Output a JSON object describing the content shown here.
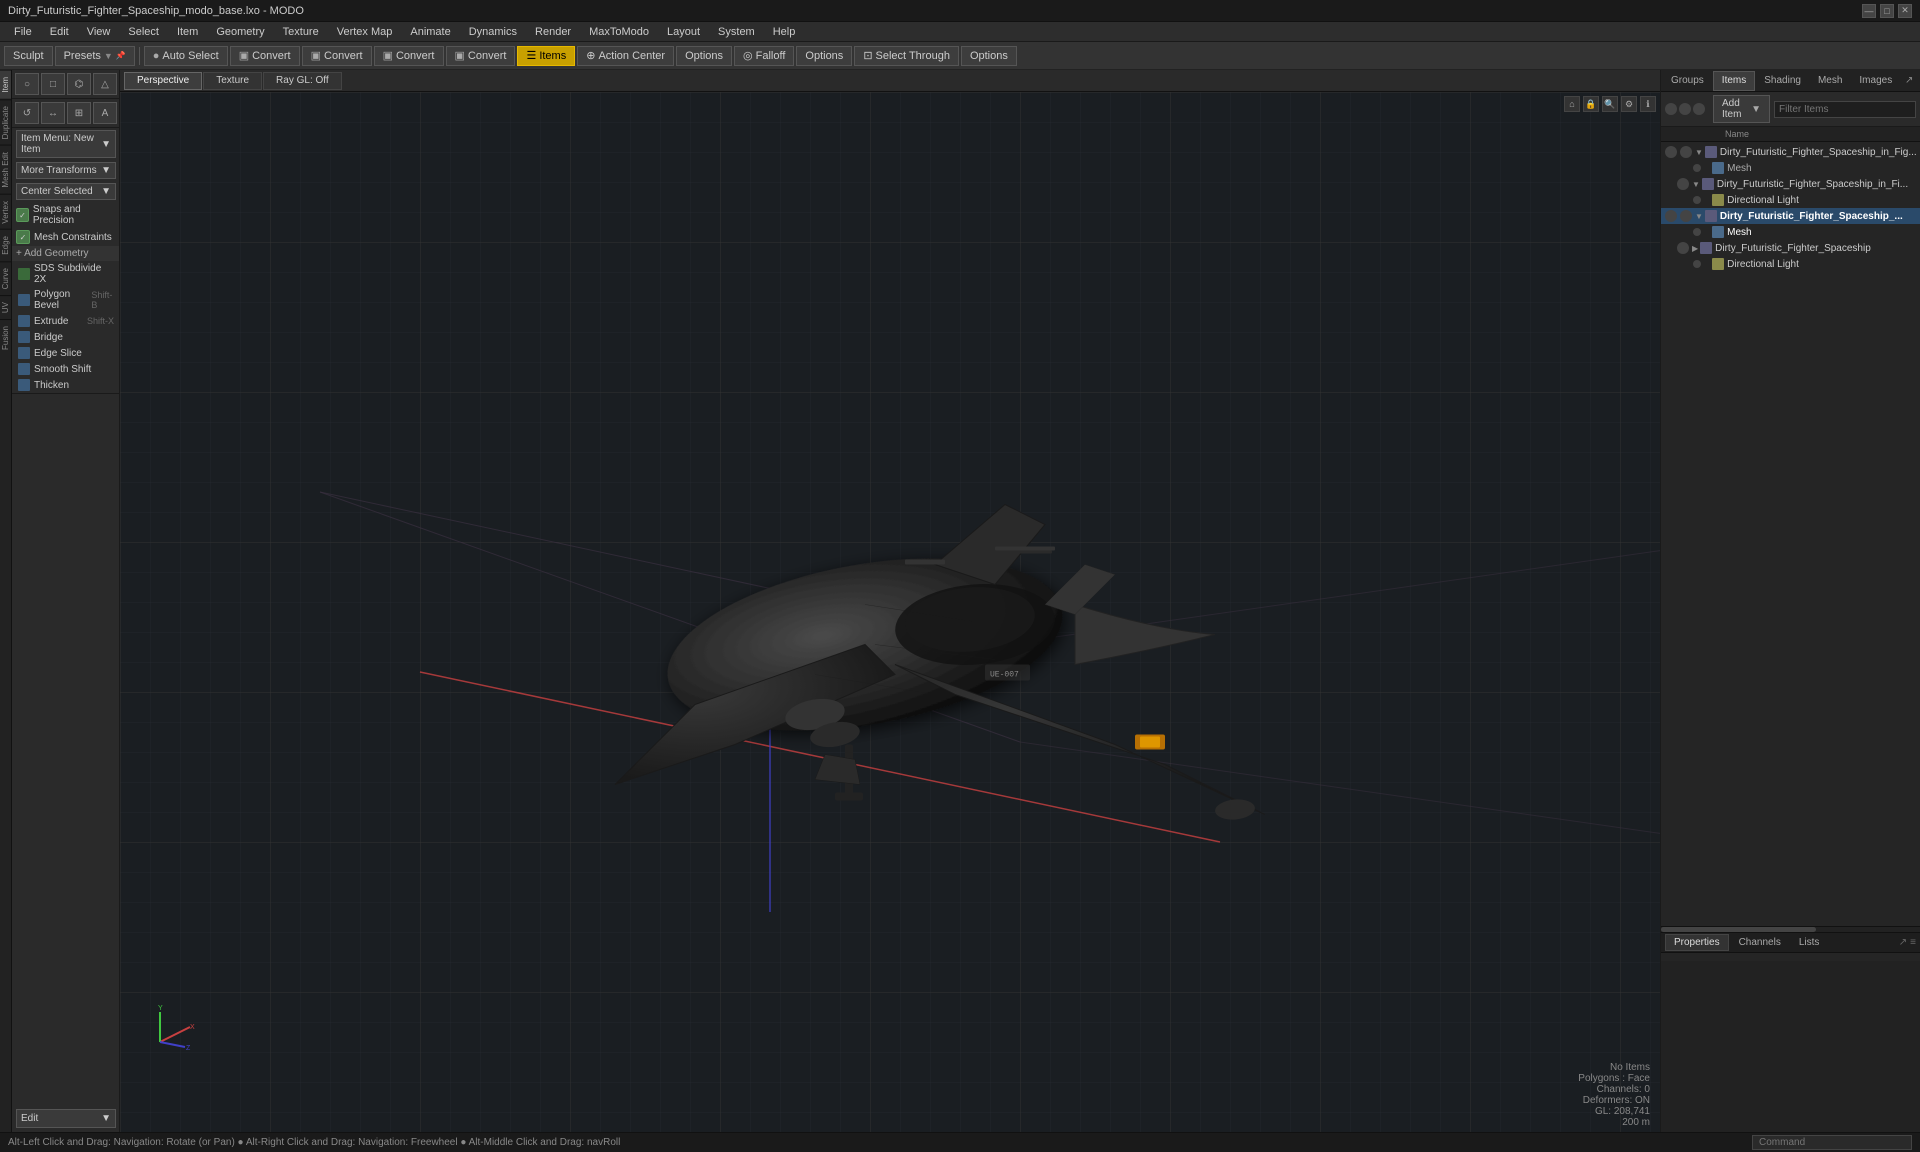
{
  "titlebar": {
    "title": "Dirty_Futuristic_Fighter_Spaceship_modo_base.lxo - MODO",
    "controls": [
      "—",
      "□",
      "✕"
    ]
  },
  "menubar": {
    "items": [
      "File",
      "Edit",
      "View",
      "Select",
      "Item",
      "Geometry",
      "Texture",
      "Vertex Map",
      "Animate",
      "Dynamics",
      "Render",
      "MaxToModo",
      "Layout",
      "System",
      "Help"
    ]
  },
  "toolbar": {
    "sculpt_label": "Sculpt",
    "presets_label": "Presets",
    "buttons": [
      {
        "label": "Auto Select",
        "icon": "●",
        "active": false
      },
      {
        "label": "Convert",
        "icon": "▣",
        "active": false
      },
      {
        "label": "Convert",
        "icon": "▣",
        "active": false
      },
      {
        "label": "Convert",
        "icon": "▣",
        "active": false
      },
      {
        "label": "Convert",
        "icon": "▣",
        "active": false
      },
      {
        "label": "Items",
        "icon": "☰",
        "active": true
      },
      {
        "label": "Action Center",
        "icon": "⊕",
        "active": false
      },
      {
        "label": "Options",
        "icon": "",
        "active": false
      },
      {
        "label": "Falloff",
        "icon": "◎",
        "active": false
      },
      {
        "label": "Options",
        "icon": "",
        "active": false
      },
      {
        "label": "Select Through",
        "icon": "⊡",
        "active": false
      },
      {
        "label": "Options",
        "icon": "",
        "active": false
      }
    ]
  },
  "left_panel": {
    "tool_icons_row1": [
      {
        "icon": "○",
        "name": "sphere"
      },
      {
        "icon": "□",
        "name": "box"
      },
      {
        "icon": "⌬",
        "name": "cone"
      },
      {
        "icon": "△",
        "name": "tri"
      }
    ],
    "tool_icons_row2": [
      {
        "icon": "↺",
        "name": "rotate"
      },
      {
        "icon": "↔",
        "name": "move"
      },
      {
        "icon": "⊞",
        "name": "scale"
      },
      {
        "icon": "A",
        "name": "text"
      }
    ],
    "dropdowns": [
      {
        "label": "Item Menu: New Item",
        "value": "Item Menu: New Item"
      },
      {
        "label": "More Transforms",
        "value": "More Transforms"
      },
      {
        "label": "Center Selected",
        "value": "Center Selected"
      }
    ],
    "tools": [
      {
        "label": "Snaps and Precision",
        "icon": "check",
        "shortcut": ""
      },
      {
        "label": "Mesh Constraints",
        "icon": "check",
        "shortcut": ""
      }
    ],
    "add_geometry": {
      "header": "+ Add Geometry",
      "items": [
        {
          "label": "SDS Subdivide 2X",
          "shortcut": ""
        },
        {
          "label": "Polygon Bevel",
          "shortcut": "Shift-B"
        },
        {
          "label": "Extrude",
          "shortcut": "Shift-X"
        },
        {
          "label": "Bridge",
          "shortcut": ""
        },
        {
          "label": "Edge Slice",
          "shortcut": ""
        },
        {
          "label": "Smooth Shift",
          "shortcut": ""
        },
        {
          "label": "Thicken",
          "shortcut": ""
        }
      ]
    },
    "mode": "Edit",
    "side_tabs": [
      "Item",
      "Duplicate",
      "Mesh Edit",
      "Vertex",
      "Edge",
      "Curve",
      "UV",
      "Fusion"
    ]
  },
  "viewport": {
    "tabs": [
      "Perspective",
      "Texture",
      "Ray GL: Off"
    ],
    "status": {
      "polygons": "No Items",
      "face": "Polygons : Face",
      "channels": "Channels: 0",
      "deformers": "Deformers: ON",
      "gl": "GL: 208,741",
      "units": "200 m"
    }
  },
  "right_panel": {
    "tabs": [
      "Groups",
      "Items",
      "Shading",
      "Mesh",
      "Images"
    ],
    "active_tab": "Items",
    "add_item_label": "Add Item",
    "filter_placeholder": "Filter Items",
    "col_headers": [
      "",
      "",
      "",
      "Name"
    ],
    "tree_items": [
      {
        "id": "item1",
        "label": "Dirty_Futuristic_Fighter_Spaceship_in_Fig...",
        "indent": 1,
        "expanded": true,
        "type": "group"
      },
      {
        "id": "item2",
        "label": "Mesh",
        "indent": 3,
        "expanded": false,
        "type": "mesh"
      },
      {
        "id": "item3",
        "label": "Dirty_Futuristic_Fighter_Spaceship_in_Fi...",
        "indent": 2,
        "expanded": true,
        "type": "group"
      },
      {
        "id": "item4",
        "label": "Directional Light",
        "indent": 3,
        "expanded": false,
        "type": "light"
      },
      {
        "id": "item5",
        "label": "Dirty_Futuristic_Fighter_Spaceship_...",
        "indent": 1,
        "expanded": true,
        "selected": true,
        "type": "group"
      },
      {
        "id": "item6",
        "label": "Mesh",
        "indent": 3,
        "expanded": false,
        "type": "mesh"
      },
      {
        "id": "item7",
        "label": "Dirty_Futuristic_Fighter_Spaceship",
        "indent": 2,
        "expanded": false,
        "type": "group"
      },
      {
        "id": "item8",
        "label": "Directional Light",
        "indent": 3,
        "expanded": false,
        "type": "light"
      }
    ],
    "props_tabs": [
      "Properties",
      "Channels",
      "Lists"
    ]
  },
  "statusbar": {
    "text": "Alt-Left Click and Drag: Navigation: Rotate (or Pan)  ●  Alt-Right Click and Drag: Navigation: Freewheel  ●  Alt-Middle Click and Drag: navRoll",
    "command_placeholder": "Command"
  }
}
